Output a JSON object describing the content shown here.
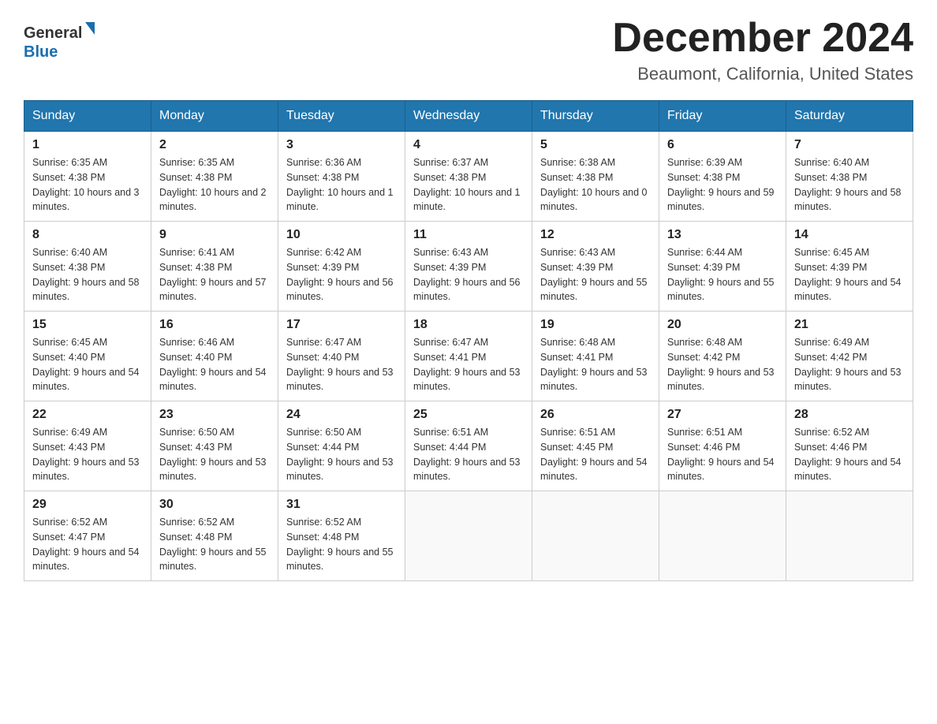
{
  "header": {
    "logo_general": "General",
    "logo_blue": "Blue",
    "month": "December 2024",
    "location": "Beaumont, California, United States"
  },
  "days_of_week": [
    "Sunday",
    "Monday",
    "Tuesday",
    "Wednesday",
    "Thursday",
    "Friday",
    "Saturday"
  ],
  "weeks": [
    [
      {
        "day": "1",
        "sunrise": "6:35 AM",
        "sunset": "4:38 PM",
        "daylight": "10 hours and 3 minutes."
      },
      {
        "day": "2",
        "sunrise": "6:35 AM",
        "sunset": "4:38 PM",
        "daylight": "10 hours and 2 minutes."
      },
      {
        "day": "3",
        "sunrise": "6:36 AM",
        "sunset": "4:38 PM",
        "daylight": "10 hours and 1 minute."
      },
      {
        "day": "4",
        "sunrise": "6:37 AM",
        "sunset": "4:38 PM",
        "daylight": "10 hours and 1 minute."
      },
      {
        "day": "5",
        "sunrise": "6:38 AM",
        "sunset": "4:38 PM",
        "daylight": "10 hours and 0 minutes."
      },
      {
        "day": "6",
        "sunrise": "6:39 AM",
        "sunset": "4:38 PM",
        "daylight": "9 hours and 59 minutes."
      },
      {
        "day": "7",
        "sunrise": "6:40 AM",
        "sunset": "4:38 PM",
        "daylight": "9 hours and 58 minutes."
      }
    ],
    [
      {
        "day": "8",
        "sunrise": "6:40 AM",
        "sunset": "4:38 PM",
        "daylight": "9 hours and 58 minutes."
      },
      {
        "day": "9",
        "sunrise": "6:41 AM",
        "sunset": "4:38 PM",
        "daylight": "9 hours and 57 minutes."
      },
      {
        "day": "10",
        "sunrise": "6:42 AM",
        "sunset": "4:39 PM",
        "daylight": "9 hours and 56 minutes."
      },
      {
        "day": "11",
        "sunrise": "6:43 AM",
        "sunset": "4:39 PM",
        "daylight": "9 hours and 56 minutes."
      },
      {
        "day": "12",
        "sunrise": "6:43 AM",
        "sunset": "4:39 PM",
        "daylight": "9 hours and 55 minutes."
      },
      {
        "day": "13",
        "sunrise": "6:44 AM",
        "sunset": "4:39 PM",
        "daylight": "9 hours and 55 minutes."
      },
      {
        "day": "14",
        "sunrise": "6:45 AM",
        "sunset": "4:39 PM",
        "daylight": "9 hours and 54 minutes."
      }
    ],
    [
      {
        "day": "15",
        "sunrise": "6:45 AM",
        "sunset": "4:40 PM",
        "daylight": "9 hours and 54 minutes."
      },
      {
        "day": "16",
        "sunrise": "6:46 AM",
        "sunset": "4:40 PM",
        "daylight": "9 hours and 54 minutes."
      },
      {
        "day": "17",
        "sunrise": "6:47 AM",
        "sunset": "4:40 PM",
        "daylight": "9 hours and 53 minutes."
      },
      {
        "day": "18",
        "sunrise": "6:47 AM",
        "sunset": "4:41 PM",
        "daylight": "9 hours and 53 minutes."
      },
      {
        "day": "19",
        "sunrise": "6:48 AM",
        "sunset": "4:41 PM",
        "daylight": "9 hours and 53 minutes."
      },
      {
        "day": "20",
        "sunrise": "6:48 AM",
        "sunset": "4:42 PM",
        "daylight": "9 hours and 53 minutes."
      },
      {
        "day": "21",
        "sunrise": "6:49 AM",
        "sunset": "4:42 PM",
        "daylight": "9 hours and 53 minutes."
      }
    ],
    [
      {
        "day": "22",
        "sunrise": "6:49 AM",
        "sunset": "4:43 PM",
        "daylight": "9 hours and 53 minutes."
      },
      {
        "day": "23",
        "sunrise": "6:50 AM",
        "sunset": "4:43 PM",
        "daylight": "9 hours and 53 minutes."
      },
      {
        "day": "24",
        "sunrise": "6:50 AM",
        "sunset": "4:44 PM",
        "daylight": "9 hours and 53 minutes."
      },
      {
        "day": "25",
        "sunrise": "6:51 AM",
        "sunset": "4:44 PM",
        "daylight": "9 hours and 53 minutes."
      },
      {
        "day": "26",
        "sunrise": "6:51 AM",
        "sunset": "4:45 PM",
        "daylight": "9 hours and 54 minutes."
      },
      {
        "day": "27",
        "sunrise": "6:51 AM",
        "sunset": "4:46 PM",
        "daylight": "9 hours and 54 minutes."
      },
      {
        "day": "28",
        "sunrise": "6:52 AM",
        "sunset": "4:46 PM",
        "daylight": "9 hours and 54 minutes."
      }
    ],
    [
      {
        "day": "29",
        "sunrise": "6:52 AM",
        "sunset": "4:47 PM",
        "daylight": "9 hours and 54 minutes."
      },
      {
        "day": "30",
        "sunrise": "6:52 AM",
        "sunset": "4:48 PM",
        "daylight": "9 hours and 55 minutes."
      },
      {
        "day": "31",
        "sunrise": "6:52 AM",
        "sunset": "4:48 PM",
        "daylight": "9 hours and 55 minutes."
      },
      null,
      null,
      null,
      null
    ]
  ],
  "labels": {
    "sunrise": "Sunrise:",
    "sunset": "Sunset:",
    "daylight": "Daylight:"
  }
}
